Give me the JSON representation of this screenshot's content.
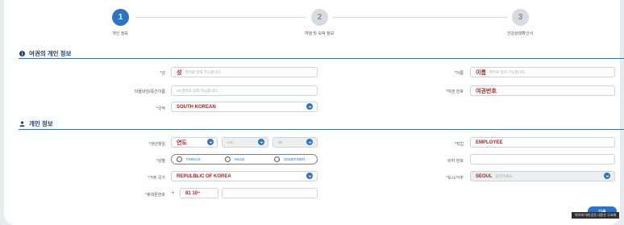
{
  "stepper": {
    "steps": [
      {
        "number": "1",
        "label": "개인 정보",
        "active": true
      },
      {
        "number": "2",
        "label": "여행 및 숙박 정보",
        "active": false
      },
      {
        "number": "3",
        "label": "건강상태확인서",
        "active": false
      }
    ]
  },
  "passport_section": {
    "title": "여권의 개인 정보",
    "icon": "info-circle-icon",
    "surname": {
      "label": "성",
      "value": "성",
      "placeholder": "영어로 입력 가능합니다."
    },
    "given_name": {
      "label": "이름",
      "value": "이름",
      "placeholder": "영어로 입력 가능합니다."
    },
    "middle_name": {
      "label": "미들네임/중간이름",
      "placeholder": "42 영어로 입력 가능합니다."
    },
    "passport_no": {
      "label": "여권 번호",
      "value": "여권번호"
    },
    "nationality": {
      "label": "국적",
      "value": "SOUTH KOREAN"
    }
  },
  "personal_section": {
    "title": "개인 정보",
    "icon": "person-icon",
    "birth": {
      "label": "생년월일",
      "year": "연도",
      "month_placeholder": "mm",
      "day_placeholder": "dd"
    },
    "occupation": {
      "label": "직업",
      "value": "EMPLOYEE"
    },
    "gender": {
      "label": "성별",
      "options": [
        "FEMALE",
        "MALE",
        "UNDEFINED"
      ]
    },
    "visa": {
      "label": "비자 번호"
    },
    "residence_country": {
      "label": "거주 국가",
      "value": "REPULBLIC OF KOREA"
    },
    "city": {
      "label": "도시/거주",
      "value": "SEOUL",
      "placeholder": "입력하세요"
    },
    "phone": {
      "label": "휴대폰번호",
      "plus": "+",
      "code": "81 10~"
    }
  },
  "actions": {
    "next_label": "다음",
    "tooltip": "위치에 대한검증 내용은 무효해"
  },
  "colors": {
    "accent": "#2b74c6",
    "value_red": "#b51c1c",
    "section_title": "#1f3f73"
  }
}
